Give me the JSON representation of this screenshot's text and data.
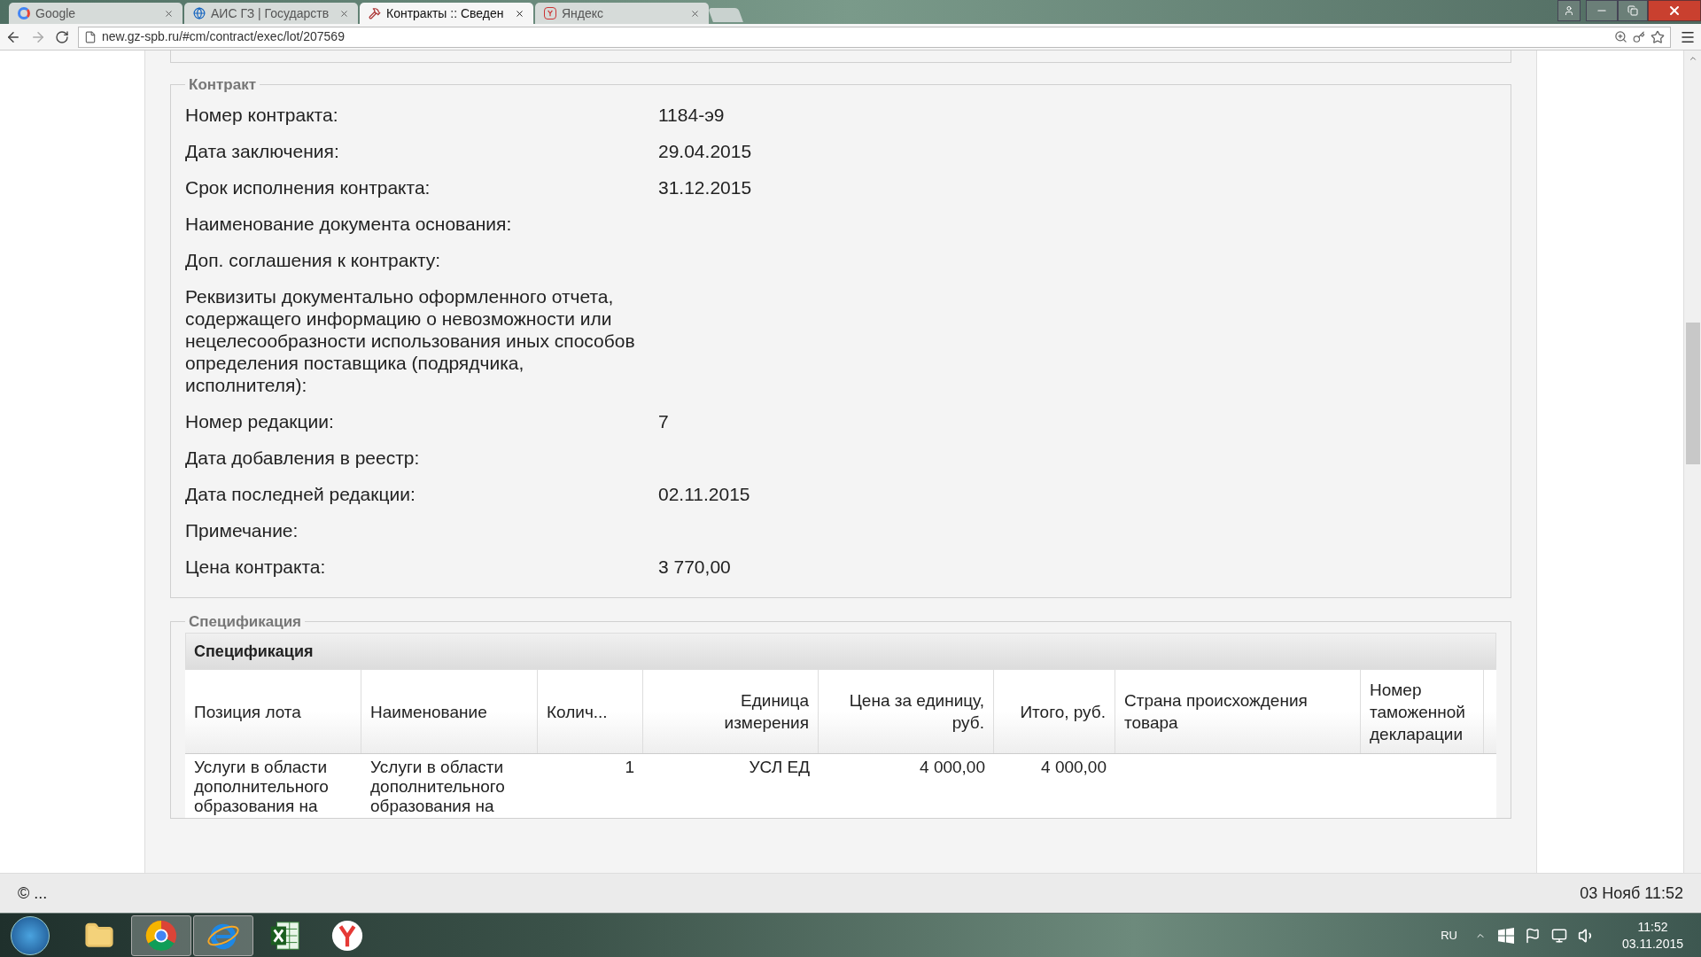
{
  "browser": {
    "tabs": [
      {
        "label": "Google",
        "selected": false
      },
      {
        "label": "АИС ГЗ | Государств",
        "selected": false
      },
      {
        "label": "Контракты :: Сведен",
        "selected": true
      },
      {
        "label": "Яндекс",
        "selected": false
      }
    ],
    "address": "new.gz-spb.ru/#cm/contract/exec/lot/207569"
  },
  "contract": {
    "legend": "Контракт",
    "fields": [
      {
        "label": "Номер контракта:",
        "value": "1184-э9"
      },
      {
        "label": "Дата заключения:",
        "value": "29.04.2015"
      },
      {
        "label": "Срок исполнения контракта:",
        "value": "31.12.2015"
      },
      {
        "label": "Наименование документа основания:"
      },
      {
        "label": "Доп. соглашения к контракту:"
      },
      {
        "label": "Реквизиты документально оформленного отчета, содержащего информацию о невозможности или нецелесообразности использования иных способов определения поставщика (подрядчика, исполнителя):"
      },
      {
        "label": "Номер редакции:",
        "value": "7"
      },
      {
        "label": "Дата добавления в реестр:"
      },
      {
        "label": "Дата последней редакции:",
        "value": "02.11.2015"
      },
      {
        "label": "Примечание:"
      },
      {
        "label": "Цена контракта:",
        "value": "3 770,00"
      }
    ]
  },
  "specification": {
    "legend": "Спецификация",
    "table": {
      "title": "Спецификация",
      "columns": [
        "Позиция лота",
        "Наименование",
        "Колич...",
        "Единица измерения",
        "Цена за единицу, руб.",
        "Итого, руб.",
        "Страна происхождения товара",
        "Номер таможенной декларации"
      ],
      "rows": [
        [
          "Услуги в области дополнительного образования на",
          "Услуги в области дополнительного образования на",
          "1",
          "УСЛ ЕД",
          "4 000,00",
          "4 000,00"
        ]
      ]
    }
  },
  "status_bar": {
    "left": "© ...",
    "right": "03 Нояб 11:52"
  },
  "taskbar": {
    "apps": [
      {
        "selected": false
      },
      {
        "selected": true
      },
      {
        "selected": true
      },
      {
        "selected": false
      },
      {
        "selected": false
      }
    ],
    "language": "RU",
    "time": "11:52",
    "date": "03.11.2015"
  }
}
